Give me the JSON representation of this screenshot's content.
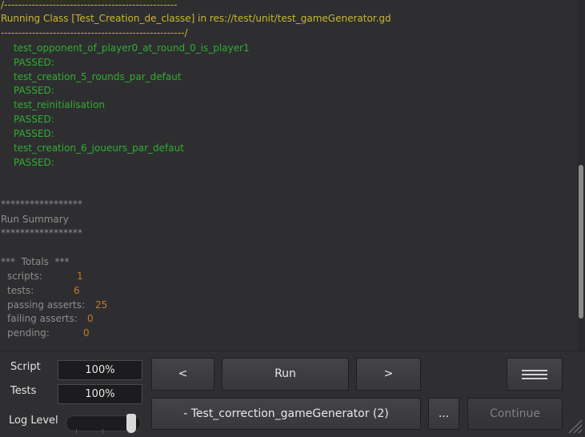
{
  "log": {
    "separator_top": "/--------------------------------------------------",
    "class_header": "Running Class [Test_Creation_de_classe] in res://test/unit/test_gameGenerator.gd",
    "separator_bottom": "-----------------------------------------------------/",
    "lines": [
      "test_opponent_of_player0_at_round_0_is_player1",
      "PASSED:",
      "test_creation_5_rounds_par_defaut",
      "PASSED:",
      "test_reinitialisation",
      "PASSED:",
      "PASSED:",
      "test_creation_6_joueurs_par_defaut",
      "PASSED:"
    ],
    "stars_1": "*****************",
    "summary_title": "Run Summary",
    "stars_2": "*****************",
    "totals_title": "***  Totals  ***",
    "totals": [
      {
        "label": "scripts:",
        "value": "1"
      },
      {
        "label": "tests:",
        "value": "6"
      },
      {
        "label": "passing asserts:",
        "value": "25"
      },
      {
        "label": "failing asserts:",
        "value": "0"
      },
      {
        "label": "pending:",
        "value": "0"
      }
    ]
  },
  "panel": {
    "script_label": "Script",
    "script_progress": "100%",
    "tests_label": "Tests",
    "tests_progress": "100%",
    "log_level_label": "Log Level",
    "prev_label": "<",
    "run_label": "Run",
    "next_label": ">",
    "script_select": "- Test_correction_gameGenerator (2)",
    "more_label": "...",
    "continue_label": "Continue",
    "log_level_value": 4,
    "log_level_max": 4
  },
  "colors": {
    "header": "#c8b82e",
    "passed": "#2fae2f",
    "summary": "#8d8d8d",
    "values": "#c47a2a"
  }
}
